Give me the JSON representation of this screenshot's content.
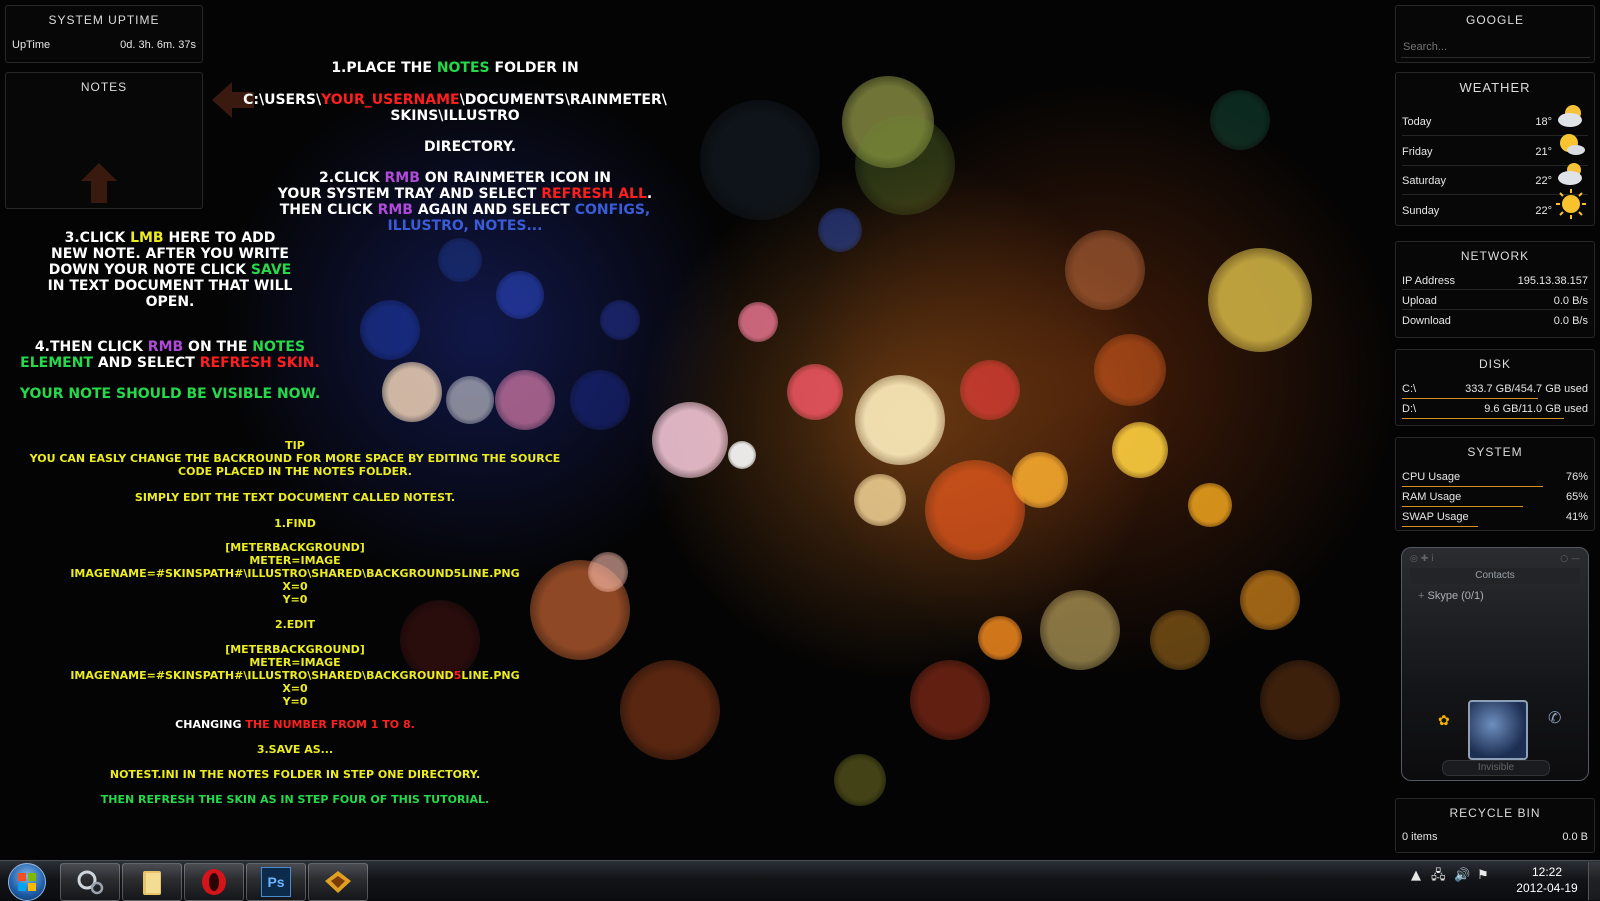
{
  "skins": {
    "uptime": {
      "title": "SYSTEM UPTIME",
      "label": "UpTime",
      "value": "0d. 3h. 6m. 37s"
    },
    "notes": {
      "title": "NOTES"
    },
    "google": {
      "title": "GOOGLE",
      "placeholder": "Search..."
    },
    "weather": {
      "title": "WEATHER",
      "days": [
        {
          "day": "Today",
          "temp": "18°",
          "icon": "cloud-sun-icon"
        },
        {
          "day": "Friday",
          "temp": "21°",
          "icon": "sun-cloud-icon"
        },
        {
          "day": "Saturday",
          "temp": "22°",
          "icon": "cloud-sun-icon"
        },
        {
          "day": "Sunday",
          "temp": "22°",
          "icon": "sun-icon"
        }
      ]
    },
    "network": {
      "title": "NETWORK",
      "rows": [
        {
          "label": "IP Address",
          "value": "195.13.38.157"
        },
        {
          "label": "Upload",
          "value": "0.0 B/s"
        },
        {
          "label": "Download",
          "value": "0.0 B/s"
        }
      ]
    },
    "disk": {
      "title": "DISK",
      "rows": [
        {
          "label": "C:\\",
          "value": "333.7 GB/454.7 GB used",
          "fraction": 0.73
        },
        {
          "label": "D:\\",
          "value": "9.6 GB/11.0 GB used",
          "fraction": 0.87
        }
      ]
    },
    "system": {
      "title": "SYSTEM",
      "rows": [
        {
          "label": "CPU Usage",
          "value": "76%",
          "fraction": 0.76
        },
        {
          "label": "RAM Usage",
          "value": "65%",
          "fraction": 0.65
        },
        {
          "label": "SWAP Usage",
          "value": "41%",
          "fraction": 0.41
        }
      ]
    },
    "skype": {
      "header": "Contacts",
      "group": "Skype (0/1)",
      "status": "Invisible"
    },
    "recycle": {
      "title": "RECYCLE BIN",
      "items": "0 items",
      "size": "0.0 B"
    }
  },
  "tutorial": {
    "step1a": "1.PLACE THE ",
    "step1b": "NOTES",
    "step1c": " FOLDER IN",
    "path1": "C:\\USERS\\",
    "path2": "YOUR_USERNAME",
    "path3": "\\DOCUMENTS\\RAINMETER\\",
    "path4": "SKINS\\ILLUSTRO",
    "dir": "DIRECTORY.",
    "step2a": "2.CLICK ",
    "step2b": "RMB",
    "step2c": " ON RAINMETER ICON IN",
    "step2d": "YOUR SYSTEM TRAY AND SELECT ",
    "step2e": "REFRESH ALL",
    "step2f": ".",
    "step2g": "THEN CLICK ",
    "step2h": "RMB",
    "step2i": " AGAIN AND SELECT ",
    "step2j": "CONFIGS,",
    "step2k": "ILLUSTRO, NOTES...",
    "step3a": "3.CLICK ",
    "step3b": "LMB",
    "step3c": " HERE TO ADD",
    "step3d": "NEW NOTE. AFTER YOU WRITE",
    "step3e": "DOWN YOUR NOTE CLICK ",
    "step3f": "SAVE",
    "step3g": "IN TEXT DOCUMENT THAT WILL",
    "step3h": "OPEN.",
    "step4a": "4.THEN CLICK ",
    "step4b": "RMB",
    "step4c": " ON THE ",
    "step4d": "NOTES",
    "step4e": "ELEMENT",
    "step4f": " AND SELECT ",
    "step4g": "REFRESH SKIN.",
    "visible": "YOUR NOTE SHOULD BE VISIBLE NOW.",
    "tip": "TIP",
    "tip1": "YOU CAN EASLY CHANGE THE BACKROUND FOR MORE SPACE BY EDITING THE SOURCE",
    "tip2": "CODE PLACED IN THE NOTES FOLDER.",
    "edit": "SIMPLY EDIT THE TEXT DOCUMENT CALLED NOTEST.",
    "find": "1.FIND",
    "f1": "[METERBACKGROUND]",
    "f2": "METER=IMAGE",
    "f3": "IMAGENAME=#SKINSPATH#\\ILLUSTRO\\SHARED\\BACKGROUND5LINE.PNG",
    "f4": "X=0",
    "f5": "Y=0",
    "edit2": "2.EDIT",
    "e1": "[METERBACKGROUND]",
    "e2": "METER=IMAGE",
    "e3a": "IMAGENAME=#SKINSPATH#\\ILLUSTRO\\SHARED\\BACKGROUND",
    "e3b": "5",
    "e3c": "LINE.PNG",
    "e4": "X=0",
    "e5": "Y=0",
    "chg1": "CHANGING ",
    "chg2": "THE NUMBER FROM 1 TO 8.",
    "save": "3.SAVE AS...",
    "ini": "NOTEST.INI IN THE NOTES FOLDER IN STEP ONE DIRECTORY.",
    "refresh": "THEN REFRESH THE SKIN AS IN STEP FOUR OF THIS TUTORIAL."
  },
  "taskbar": {
    "apps": [
      "control-panel-icon",
      "explorer-folder-icon",
      "opera-icon",
      "photoshop-icon",
      "winamp-icon"
    ],
    "photoshop_label": "Ps",
    "clock_time": "12:22",
    "clock_date": "2012-04-19"
  },
  "colors": {
    "green": "#25d94a",
    "red": "#ff1e1e",
    "purple": "#b04ad8",
    "blue": "#3a5cd8",
    "yellow": "#ecec20",
    "bar": "#d28f23"
  }
}
